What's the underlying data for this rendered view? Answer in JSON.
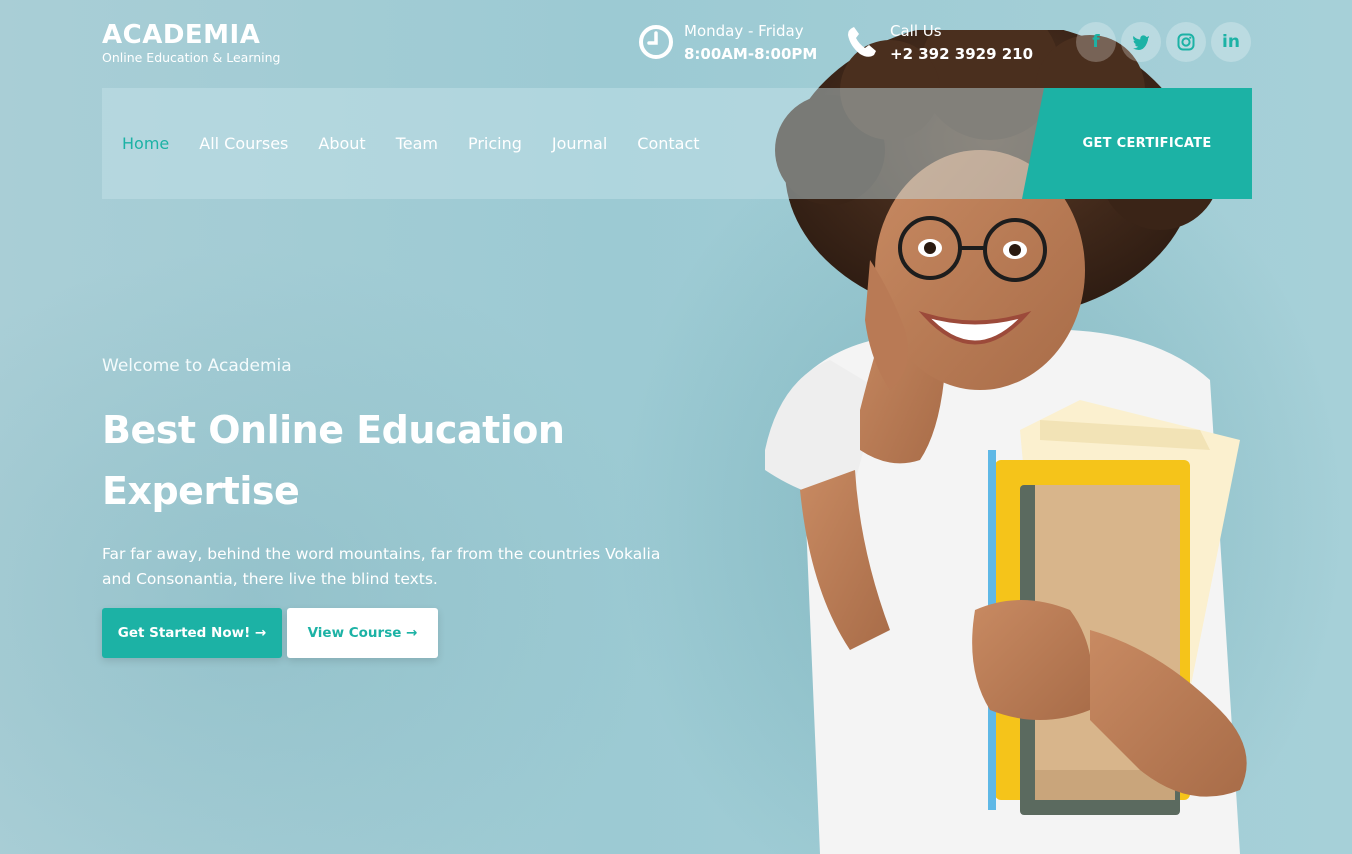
{
  "brand": {
    "title": "ACADEMIA",
    "subtitle": "Online Education & Learning"
  },
  "contact": {
    "hours_label": "Monday - Friday",
    "hours_value": "8:00AM-8:00PM",
    "call_label": "Call Us",
    "call_value": "+2 392 3929 210"
  },
  "socials": [
    {
      "icon": "facebook-icon",
      "glyph": "f"
    },
    {
      "icon": "twitter-icon",
      "glyph": "t"
    },
    {
      "icon": "instagram-icon",
      "glyph": "◎"
    },
    {
      "icon": "linkedin-icon",
      "glyph": "in"
    }
  ],
  "nav": {
    "items": [
      {
        "label": "Home",
        "active": true
      },
      {
        "label": "All Courses",
        "active": false
      },
      {
        "label": "About",
        "active": false
      },
      {
        "label": "Team",
        "active": false
      },
      {
        "label": "Pricing",
        "active": false
      },
      {
        "label": "Journal",
        "active": false
      },
      {
        "label": "Contact",
        "active": false
      }
    ],
    "cta_label": "GET CERTIFICATE"
  },
  "hero": {
    "welcome": "Welcome to Academia",
    "headline_line1": "Best Online Education",
    "headline_line2": "Expertise",
    "description": "Far far away, behind the word mountains, far from the countries Vokalia and Consonantia, there live the blind texts.",
    "primary_button": "Get Started Now! →",
    "secondary_button": "View Course →"
  },
  "colors": {
    "accent": "#1cb2a5",
    "background": "#a3ccd4"
  }
}
